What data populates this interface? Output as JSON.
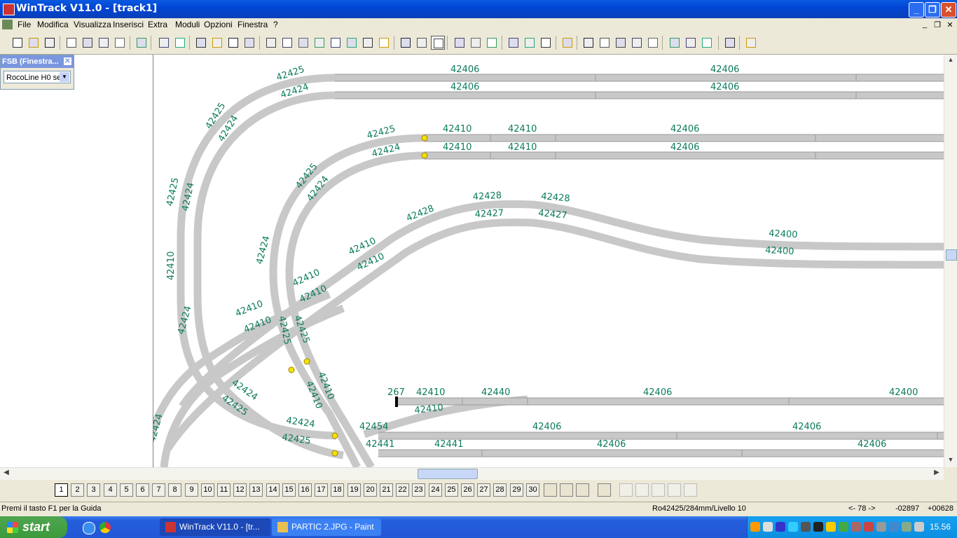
{
  "window": {
    "title": "WinTrack  V11.0 - [track1]"
  },
  "menu": {
    "items": [
      "File",
      "Modifica",
      "Visualizza",
      "Inserisci",
      "Extra",
      "Moduli",
      "Opzioni",
      "Finestra",
      "?"
    ]
  },
  "fsb": {
    "title": "FSB (Finestra...",
    "selected": "RocoLine H0 se"
  },
  "canvas": {
    "labels": [
      {
        "t": "42406"
      },
      {
        "t": "42406"
      },
      {
        "t": "42406"
      },
      {
        "t": "42406"
      },
      {
        "t": "42425"
      },
      {
        "t": "42424"
      },
      {
        "t": "42425"
      },
      {
        "t": "42424"
      },
      {
        "t": "42410"
      },
      {
        "t": "42410"
      },
      {
        "t": "42406"
      },
      {
        "t": "42410"
      },
      {
        "t": "42410"
      },
      {
        "t": "42406"
      },
      {
        "t": "42425"
      },
      {
        "t": "42424"
      },
      {
        "t": "42425"
      },
      {
        "t": "42424"
      },
      {
        "t": "42425"
      },
      {
        "t": "42424"
      },
      {
        "t": "42428"
      },
      {
        "t": "42428"
      },
      {
        "t": "42427"
      },
      {
        "t": "42428"
      },
      {
        "t": "42427"
      },
      {
        "t": "42400"
      },
      {
        "t": "42400"
      },
      {
        "t": "42410"
      },
      {
        "t": "42410"
      },
      {
        "t": "42410"
      },
      {
        "t": "42410"
      },
      {
        "t": "42410"
      },
      {
        "t": "42410"
      },
      {
        "t": "42410"
      },
      {
        "t": "267"
      },
      {
        "t": "42410"
      },
      {
        "t": "42440"
      },
      {
        "t": "42406"
      },
      {
        "t": "42400"
      },
      {
        "t": "42410"
      },
      {
        "t": "42454"
      },
      {
        "t": "42406"
      },
      {
        "t": "42406"
      },
      {
        "t": "42441"
      },
      {
        "t": "42441"
      },
      {
        "t": "42406"
      },
      {
        "t": "42406"
      },
      {
        "t": "42424"
      },
      {
        "t": "42425"
      },
      {
        "t": "42424"
      },
      {
        "t": "42425"
      },
      {
        "t": "42425"
      },
      {
        "t": "42424"
      },
      {
        "t": "42424"
      },
      {
        "t": "42425"
      },
      {
        "t": "42410"
      },
      {
        "t": "42410"
      },
      {
        "t": "42425"
      },
      {
        "t": "42424"
      }
    ]
  },
  "layers": [
    "1",
    "2",
    "3",
    "4",
    "5",
    "6",
    "7",
    "8",
    "9",
    "10",
    "11",
    "12",
    "13",
    "14",
    "15",
    "16",
    "17",
    "18",
    "19",
    "20",
    "21",
    "22",
    "23",
    "24",
    "25",
    "26",
    "27",
    "28",
    "29",
    "30"
  ],
  "status": {
    "help": "Premi il tasto F1 per la Guida",
    "element": "Ro42425/284mm/Livello 10",
    "angle": "<- 78 ->",
    "x": "-02897",
    "y": "+00628"
  },
  "taskbar": {
    "start": "start",
    "tasks": [
      "WinTrack  V11.0 - [tr...",
      "PARTIC 2.JPG - Paint"
    ],
    "clock": "15.56"
  },
  "colors": {
    "track": "#c8c8c8",
    "label": "#0b7a5c",
    "titlebar": "#0a5ae0"
  },
  "icons": {
    "window_controls": [
      "minimize-icon",
      "restore-icon",
      "close-icon"
    ]
  }
}
